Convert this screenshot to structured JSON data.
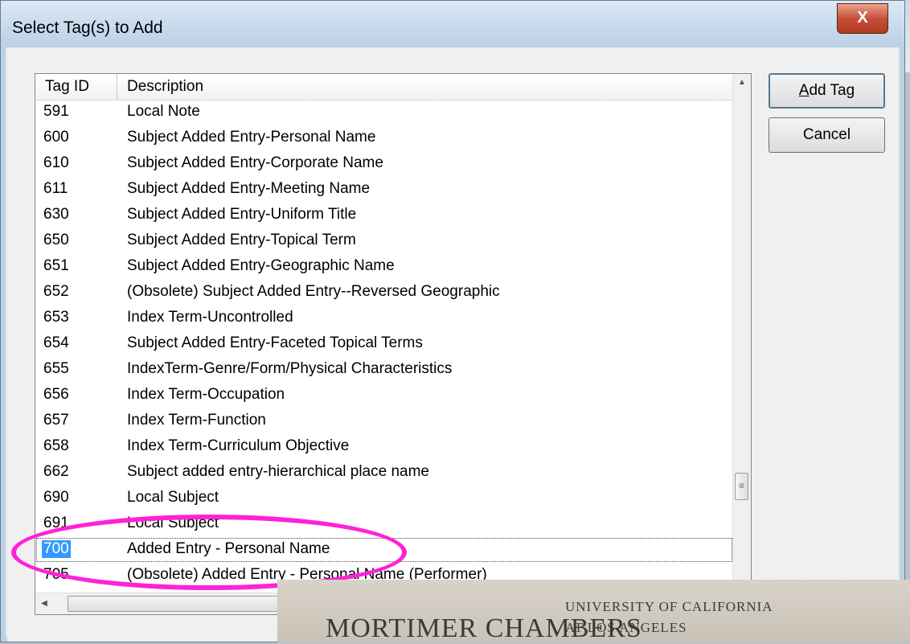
{
  "dialog": {
    "title": "Select Tag(s) to Add",
    "close_label": "X"
  },
  "list": {
    "columns": [
      "Tag ID",
      "Description"
    ],
    "rows": [
      {
        "id": "591",
        "desc": "Local Note"
      },
      {
        "id": "600",
        "desc": "Subject Added Entry-Personal Name"
      },
      {
        "id": "610",
        "desc": "Subject Added Entry-Corporate Name"
      },
      {
        "id": "611",
        "desc": "Subject Added Entry-Meeting Name"
      },
      {
        "id": "630",
        "desc": "Subject Added Entry-Uniform Title"
      },
      {
        "id": "650",
        "desc": "Subject Added Entry-Topical Term"
      },
      {
        "id": "651",
        "desc": "Subject Added Entry-Geographic Name"
      },
      {
        "id": "652",
        "desc": "(Obsolete) Subject Added Entry--Reversed Geographic"
      },
      {
        "id": "653",
        "desc": "Index Term-Uncontrolled"
      },
      {
        "id": "654",
        "desc": "Subject Added Entry-Faceted Topical Terms"
      },
      {
        "id": "655",
        "desc": "IndexTerm-Genre/Form/Physical Characteristics"
      },
      {
        "id": "656",
        "desc": "Index Term-Occupation"
      },
      {
        "id": "657",
        "desc": "Index Term-Function"
      },
      {
        "id": "658",
        "desc": "Index Term-Curriculum Objective"
      },
      {
        "id": "662",
        "desc": "Subject added entry-hierarchical place name"
      },
      {
        "id": "690",
        "desc": "Local Subject"
      },
      {
        "id": "691",
        "desc": "Local Subject"
      },
      {
        "id": "700",
        "desc": "Added Entry - Personal Name"
      },
      {
        "id": "705",
        "desc": "(Obsolete) Added Entry - Personal Name (Performer)"
      }
    ],
    "selected_id": "700"
  },
  "buttons": {
    "add_tag_prefix": "A",
    "add_tag_rest": "dd Tag",
    "cancel": "Cancel"
  },
  "overlay_image": {
    "line1": "MORTIMER CHAMBERS",
    "line2": "UNIVERSITY OF CALIFORNIA",
    "line3": "AT LOS ANGELES"
  },
  "colors": {
    "highlight_ellipse": "#ff22d6",
    "selection": "#3399ff"
  }
}
